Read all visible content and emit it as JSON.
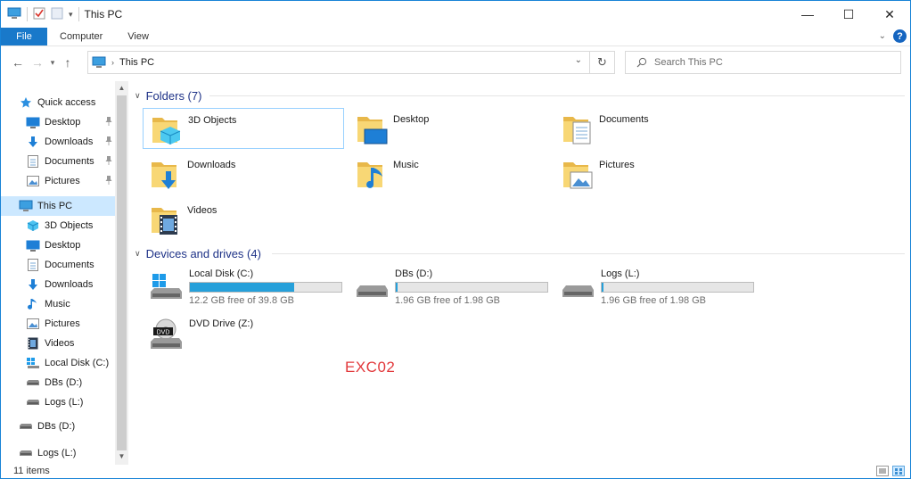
{
  "window": {
    "title": "This PC",
    "controls": {
      "minimize": "—",
      "maximize": "☐",
      "close": "✕"
    }
  },
  "ribbon": {
    "tabs": [
      "File",
      "Computer",
      "View"
    ]
  },
  "address_bar": {
    "location": "This PC",
    "search_placeholder": "Search This PC"
  },
  "nav_pane": {
    "items": [
      {
        "label": "Quick access",
        "icon": "star-icon",
        "pinned": false
      },
      {
        "label": "Desktop",
        "icon": "desktop-icon",
        "pinned": true
      },
      {
        "label": "Downloads",
        "icon": "download-icon",
        "pinned": true
      },
      {
        "label": "Documents",
        "icon": "document-icon",
        "pinned": true
      },
      {
        "label": "Pictures",
        "icon": "pictures-icon",
        "pinned": true
      },
      {
        "label": "This PC",
        "icon": "computer-icon",
        "selected": true
      },
      {
        "label": "3D Objects",
        "icon": "cube-icon"
      },
      {
        "label": "Desktop",
        "icon": "desktop-icon"
      },
      {
        "label": "Documents",
        "icon": "document-icon"
      },
      {
        "label": "Downloads",
        "icon": "download-icon"
      },
      {
        "label": "Music",
        "icon": "music-icon"
      },
      {
        "label": "Pictures",
        "icon": "pictures-icon"
      },
      {
        "label": "Videos",
        "icon": "video-icon"
      },
      {
        "label": "Local Disk (C:)",
        "icon": "windows-drive-icon"
      },
      {
        "label": "DBs (D:)",
        "icon": "drive-icon"
      },
      {
        "label": "Logs (L:)",
        "icon": "drive-icon"
      },
      {
        "label": "DBs (D:)",
        "icon": "drive-icon"
      },
      {
        "label": "Logs (L:)",
        "icon": "drive-icon"
      }
    ]
  },
  "folders": {
    "header": "Folders (7)",
    "items": [
      {
        "label": "3D Objects",
        "icon": "cube-folder-icon"
      },
      {
        "label": "Desktop",
        "icon": "desktop-folder-icon"
      },
      {
        "label": "Documents",
        "icon": "documents-folder-icon"
      },
      {
        "label": "Downloads",
        "icon": "downloads-folder-icon"
      },
      {
        "label": "Music",
        "icon": "music-folder-icon"
      },
      {
        "label": "Pictures",
        "icon": "pictures-folder-icon"
      },
      {
        "label": "Videos",
        "icon": "videos-folder-icon"
      }
    ]
  },
  "drives": {
    "header": "Devices and drives (4)",
    "items": [
      {
        "label": "Local Disk (C:)",
        "free": "12.2 GB free of 39.8 GB",
        "used_fraction": 0.69,
        "icon": "windows-drive-icon"
      },
      {
        "label": "DBs (D:)",
        "free": "1.96 GB free of 1.98 GB",
        "used_fraction": 0.01,
        "icon": "drive-icon"
      },
      {
        "label": "Logs (L:)",
        "free": "1.96 GB free of 1.98 GB",
        "used_fraction": 0.01,
        "icon": "drive-icon"
      },
      {
        "label": "DVD Drive (Z:)",
        "icon": "dvd-drive-icon",
        "badge": "DVD"
      }
    ]
  },
  "watermark": "EXC02",
  "status": {
    "item_count": "11 items"
  },
  "colors": {
    "accent": "#1979ca",
    "drive_bar": "#26a0da",
    "group_header": "#1e3287",
    "watermark": "#e2393c"
  }
}
